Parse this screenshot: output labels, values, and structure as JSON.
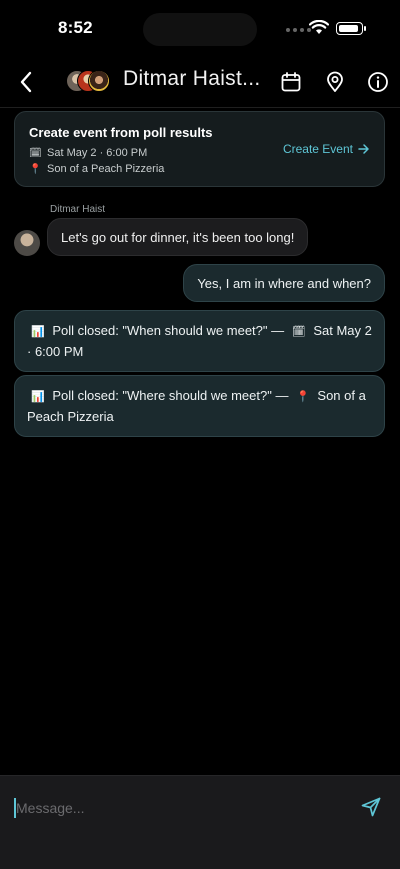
{
  "status_bar": {
    "time": "8:52"
  },
  "header": {
    "title": "Ditmar Haist...",
    "icons": [
      "back-icon",
      "calendar-icon",
      "location-pin-icon",
      "info-icon"
    ]
  },
  "event_card": {
    "title": "Create event from poll results",
    "date_icon": "🗓",
    "date": "Sat May 2 · 6:00 PM",
    "place_icon": "📍",
    "place": "Son of a Peach Pizzeria",
    "action_label": "Create Event",
    "accent": "#5ec6d6"
  },
  "messages": {
    "sender": "Ditmar Haist",
    "incoming": "Let's go out for dinner, it's been too long!",
    "outgoing": "Yes, I am in where and when?",
    "poll1": {
      "icon": "📊",
      "text": "Poll closed: \"When should we meet?\" —",
      "result_icon": "🗓",
      "result": "Sat May 2 · 6:00 PM"
    },
    "poll2": {
      "icon": "📊",
      "text": "Poll closed: \"Where should we meet?\" —",
      "result_icon": "📍",
      "result": "Son of a Peach Pizzeria"
    }
  },
  "composer": {
    "placeholder": "Message..."
  }
}
